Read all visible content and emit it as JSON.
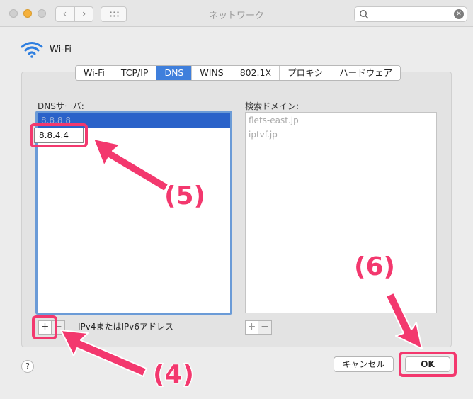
{
  "window": {
    "title": "ネットワーク"
  },
  "search": {
    "placeholder": "",
    "value": ""
  },
  "interface": {
    "name": "Wi-Fi"
  },
  "tabs": [
    {
      "label": "Wi-Fi",
      "active": false
    },
    {
      "label": "TCP/IP",
      "active": false
    },
    {
      "label": "DNS",
      "active": true
    },
    {
      "label": "WINS",
      "active": false
    },
    {
      "label": "802.1X",
      "active": false
    },
    {
      "label": "プロキシ",
      "active": false
    },
    {
      "label": "ハードウェア",
      "active": false
    }
  ],
  "dns": {
    "label": "DNSサーバ:",
    "servers": [
      "8.8.8.8",
      "8.8.4.4"
    ],
    "hint": "IPv4またはIPv6アドレス"
  },
  "domains": {
    "label": "検索ドメイン:",
    "items": [
      "flets-east.jp",
      "iptvf.jp"
    ]
  },
  "buttons": {
    "add": "+",
    "remove": "−",
    "help": "?",
    "cancel": "キャンセル",
    "ok": "OK"
  },
  "annotations": {
    "step4": "(4)",
    "step5": "(5)",
    "step6": "(6)"
  },
  "colors": {
    "accent": "#3f7fdc",
    "selection": "#2a62c9",
    "annotation": "#f3386e"
  }
}
